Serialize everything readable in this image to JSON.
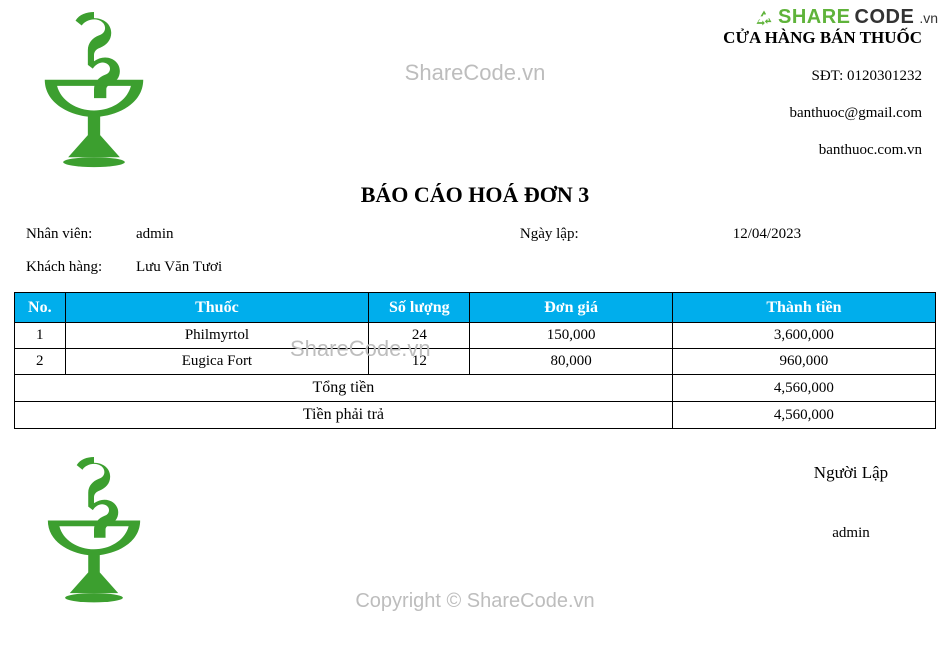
{
  "watermarks": {
    "top": "ShareCode.vn",
    "mid": "ShareCode.vn",
    "bottom": "Copyright © ShareCode.vn"
  },
  "brand_logo": {
    "share": "SHARE",
    "code": "CODE",
    "vn": ".vn"
  },
  "store": {
    "name": "CỬA HÀNG BÁN THUỐC",
    "phone_label": "SĐT: ",
    "phone": "0120301232",
    "email": "banthuoc@gmail.com",
    "website": "banthuoc.com.vn"
  },
  "title": "BÁO CÁO HOÁ ĐƠN 3",
  "info": {
    "employee_label": "Nhân viên:",
    "employee": "admin",
    "date_label": "Ngày lập:",
    "date": "12/04/2023",
    "customer_label": "Khách hàng:",
    "customer": "Lưu Văn Tươi"
  },
  "table": {
    "headers": {
      "no": "No.",
      "thuoc": "Thuốc",
      "soluong": "Số lượng",
      "dongia": "Đơn giá",
      "thanhtien": "Thành tiền"
    },
    "rows": [
      {
        "no": "1",
        "thuoc": "Philmyrtol",
        "soluong": "24",
        "dongia": "150,000",
        "thanhtien": "3,600,000"
      },
      {
        "no": "2",
        "thuoc": "Eugica Fort",
        "soluong": "12",
        "dongia": "80,000",
        "thanhtien": "960,000"
      }
    ],
    "summary": [
      {
        "label": "Tổng tiền",
        "value": "4,560,000"
      },
      {
        "label": "Tiền phải trả",
        "value": "4,560,000"
      }
    ]
  },
  "footer": {
    "signer_label": "Người Lập",
    "signer": "admin"
  },
  "colors": {
    "header_bg": "#00aeec",
    "logo_green": "#3c9f2f"
  }
}
